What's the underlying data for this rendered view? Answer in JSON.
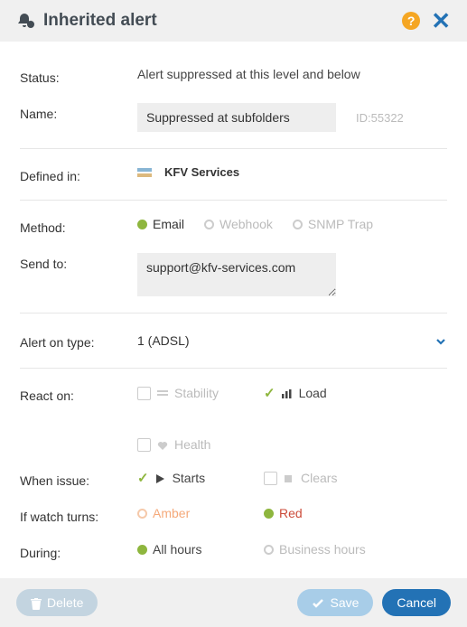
{
  "header": {
    "title": "Inherited alert"
  },
  "status": {
    "label": "Status:",
    "value": "Alert suppressed at this level and below"
  },
  "name": {
    "label": "Name:",
    "value": "Suppressed at subfolders",
    "id_prefix": "ID:",
    "id": "55322"
  },
  "defined": {
    "label": "Defined in:",
    "value": "KFV Services"
  },
  "method": {
    "label": "Method:",
    "options": {
      "email": "Email",
      "webhook": "Webhook",
      "snmp": "SNMP Trap"
    }
  },
  "sendto": {
    "label": "Send to:",
    "value": "support@kfv-services.com"
  },
  "alert_type": {
    "label": "Alert on type:",
    "value": "1 (ADSL)"
  },
  "react": {
    "label": "React on:",
    "options": {
      "stability": "Stability",
      "load": "Load",
      "health": "Health"
    }
  },
  "when": {
    "label": "When issue:",
    "options": {
      "starts": "Starts",
      "clears": "Clears"
    }
  },
  "watch": {
    "label": "If watch turns:",
    "options": {
      "amber": "Amber",
      "red": "Red"
    }
  },
  "during": {
    "label": "During:",
    "options": {
      "all": "All hours",
      "business": "Business hours"
    }
  },
  "footer": {
    "delete": "Delete",
    "save": "Save",
    "cancel": "Cancel"
  }
}
